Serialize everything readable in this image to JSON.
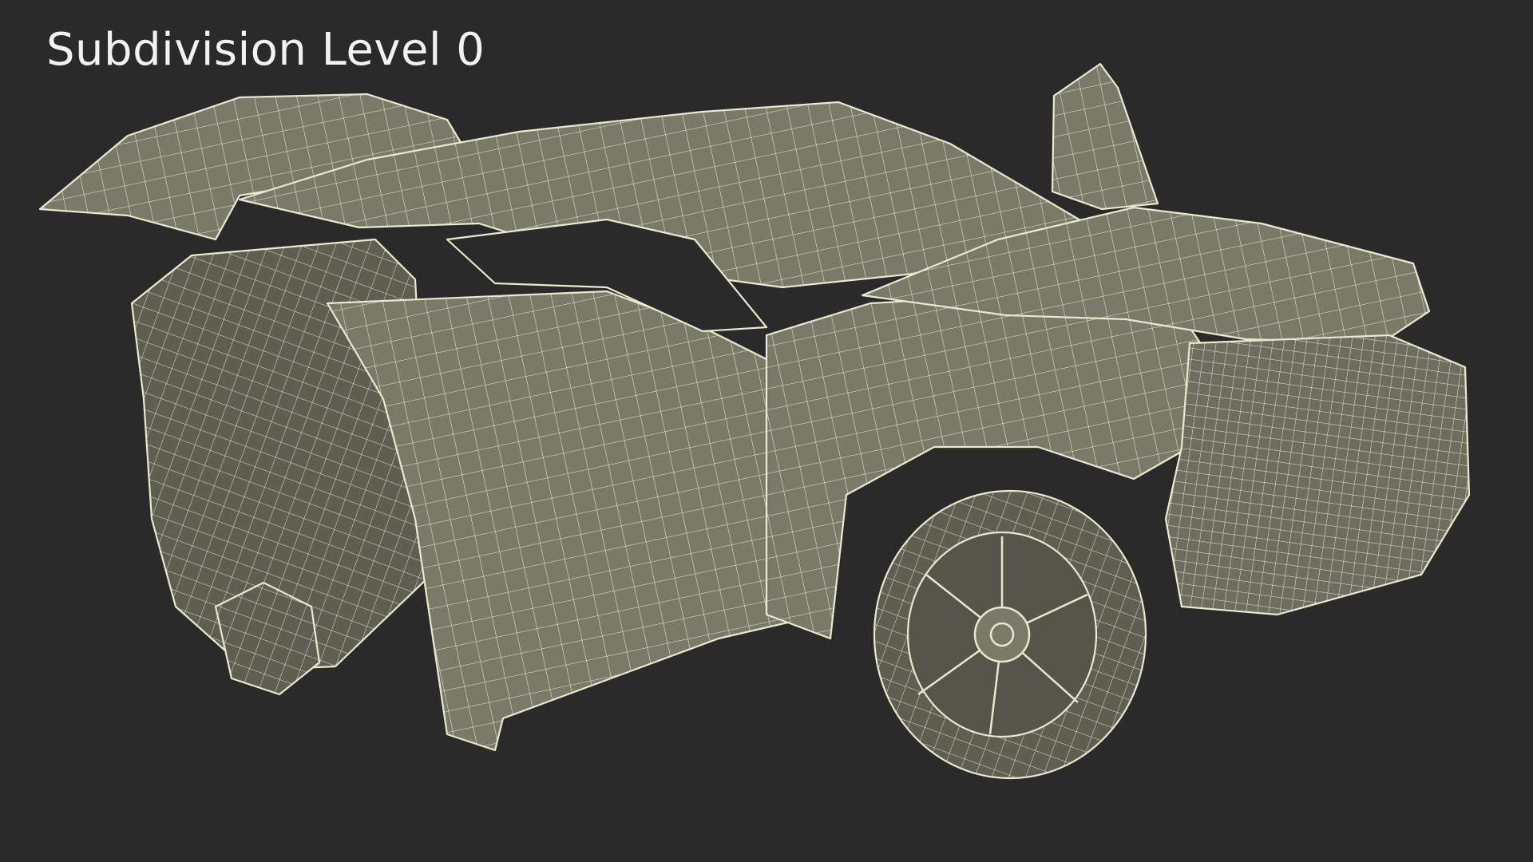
{
  "caption": "Subdivision Level 0",
  "render": {
    "background_color": "#2a2a2a",
    "mesh_fill_color": "#7a7a6a",
    "mesh_shadow_color": "#55554a",
    "wire_color": "#ece8cf",
    "subject": "wireframe car model with open doors, hatch and hood"
  }
}
